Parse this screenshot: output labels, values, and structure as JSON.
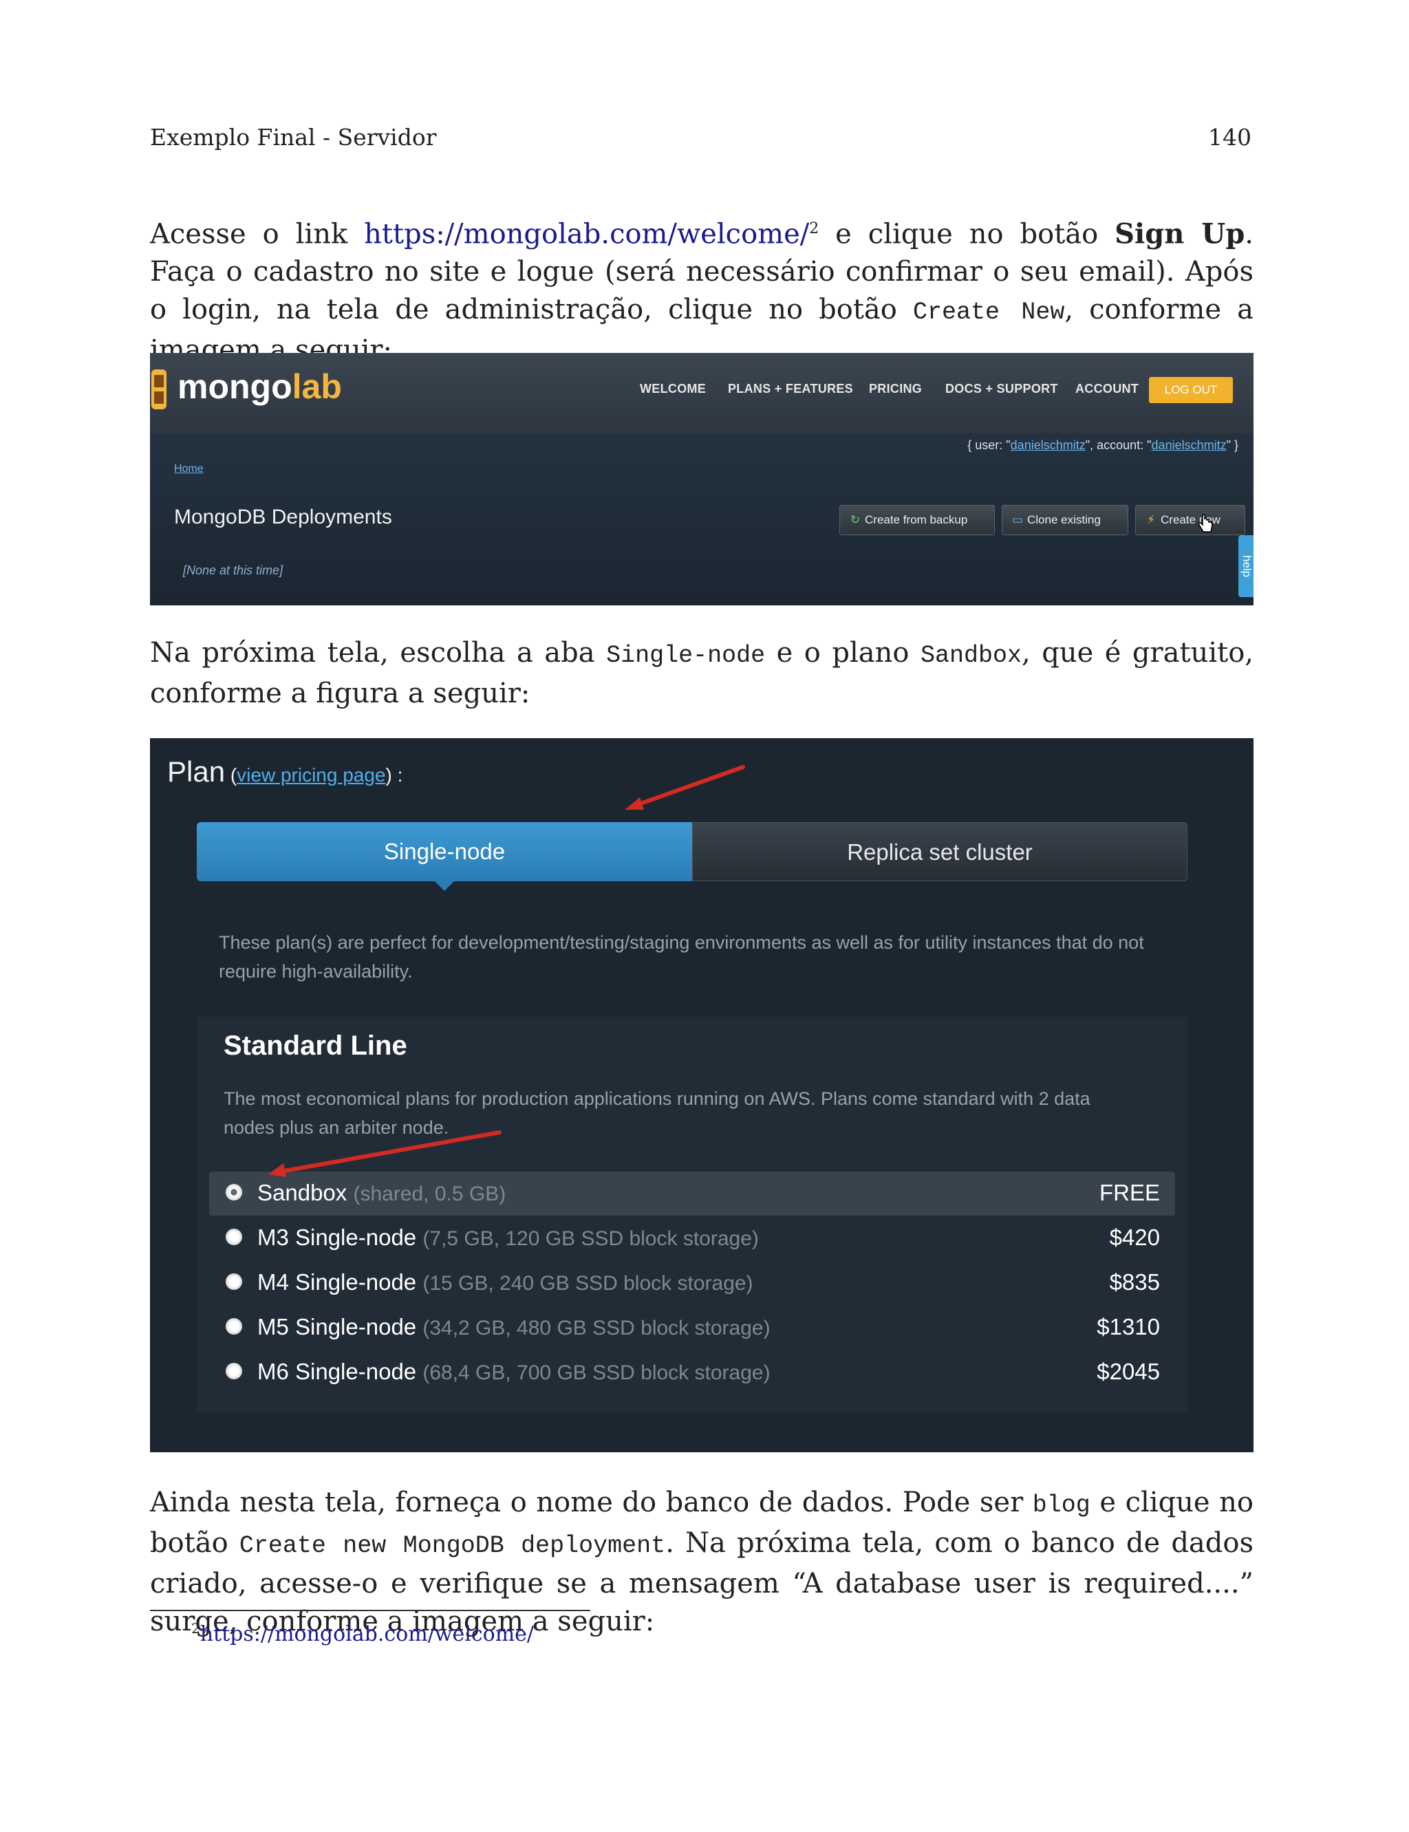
{
  "running_head": {
    "title": "Exemplo Final - Servidor",
    "page_number": "140"
  },
  "para1": {
    "t1": "Acesse o link ",
    "link": "https://mongolab.com/welcome/",
    "fn": "2",
    "t2": " e clique no botão ",
    "bold": "Sign Up",
    "t3": ". Faça o cadastro no site e logue (será necessário confirmar o seu email). Após o login, na tela de administração, clique no botão ",
    "code": "Create New",
    "t4": ", conforme a imagem a seguir:"
  },
  "shot1": {
    "logo_a": "mongo",
    "logo_b": "lab",
    "nav": [
      "WELCOME",
      "PLANS + FEATURES",
      "PRICING",
      "DOCS + SUPPORT",
      "ACCOUNT"
    ],
    "logout": "LOG OUT",
    "user_prefix": "{ user: \"",
    "user": "danielschmitz",
    "user_mid": "\", account: \"",
    "account": "danielschmitz",
    "user_suffix": "\" }",
    "breadcrumb": "Home",
    "title": "MongoDB Deployments",
    "none": "[None at this time]",
    "buttons": [
      "Create from backup",
      "Clone existing",
      "Create new"
    ],
    "help": "help",
    "icons": [
      "refresh-icon",
      "monitor-icon",
      "bolt-icon",
      "hand-cursor-icon"
    ]
  },
  "para2": {
    "t1": "Na próxima tela, escolha a aba ",
    "code1": "Single-node",
    "t2": " e o plano ",
    "code2": "Sandbox",
    "t3": ", que é gratuito, conforme a figura a seguir:"
  },
  "shot2": {
    "plan_label": "Plan",
    "link_open": " (",
    "link": "view pricing page",
    "link_close": ") :",
    "tabs": [
      "Single-node",
      "Replica set cluster"
    ],
    "desc": "These plan(s) are perfect for development/testing/staging environments as well as for utility instances that do not require high-availability.",
    "std_title": "Standard Line",
    "std_desc": "The most economical plans for production applications running on AWS. Plans come standard with 2 data nodes plus an arbiter node.",
    "plans": [
      {
        "name": "Sandbox",
        "detail": "(shared, 0.5 GB)",
        "price": "FREE"
      },
      {
        "name": "M3 Single-node",
        "detail": "(7,5 GB, 120 GB SSD block storage)",
        "price": "$420"
      },
      {
        "name": "M4 Single-node",
        "detail": "(15 GB, 240 GB SSD block storage)",
        "price": "$835"
      },
      {
        "name": "M5 Single-node",
        "detail": "(34,2 GB, 480 GB SSD block storage)",
        "price": "$1310"
      },
      {
        "name": "M6 Single-node",
        "detail": "(68,4 GB, 700 GB SSD block storage)",
        "price": "$2045"
      }
    ],
    "arrow_color": "#d42a24"
  },
  "para3": {
    "t1": "Ainda nesta tela, forneça o nome do banco de dados. Pode ser ",
    "code1": "blog",
    "t2": " e clique no botão ",
    "code2": "Create new MongoDB deployment",
    "t3": ". Na próxima tela, com o banco de dados criado, acesse-o e verifique se a mensagem “A database user is required....” surge, conforme a imagem a seguir:"
  },
  "footnote": {
    "num": "2",
    "text": "https://mongolab.com/welcome/"
  }
}
